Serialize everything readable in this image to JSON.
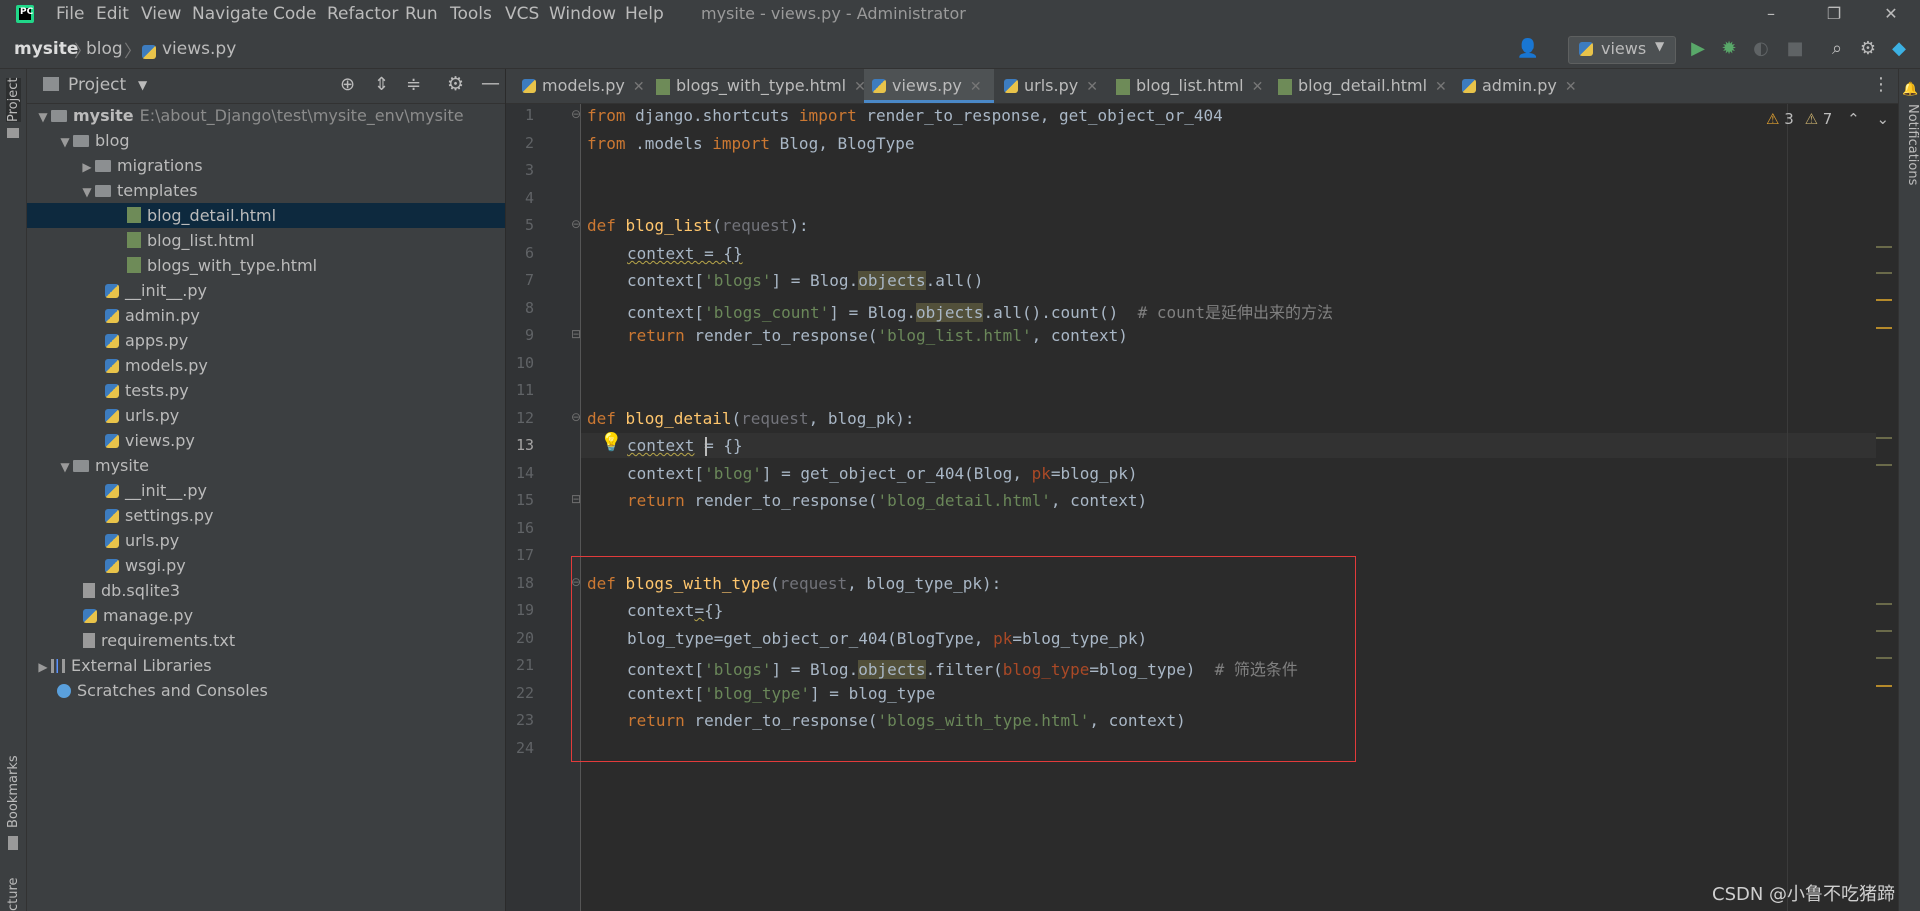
{
  "titlebar": {
    "logo": "PC",
    "menus": [
      "File",
      "Edit",
      "View",
      "Navigate",
      "Code",
      "Refactor",
      "Run",
      "Tools",
      "VCS",
      "Window",
      "Help"
    ],
    "title": "mysite - views.py - Administrator"
  },
  "breadcrumb": [
    "mysite",
    "blog",
    "views.py"
  ],
  "toolbar": {
    "run_config": "views"
  },
  "left_strip": {
    "project": "Project",
    "bookmarks": "Bookmarks",
    "structure": "cture"
  },
  "right_strip": {
    "notifications": "Notifications"
  },
  "project_panel": {
    "title": "Project",
    "root_name": "mysite",
    "root_path": "E:\\about_Django\\test\\mysite_env\\mysite",
    "items": [
      {
        "label": "blog"
      },
      {
        "label": "migrations"
      },
      {
        "label": "templates"
      },
      {
        "label": "blog_detail.html"
      },
      {
        "label": "blog_list.html"
      },
      {
        "label": "blogs_with_type.html"
      },
      {
        "label": "__init__.py"
      },
      {
        "label": "admin.py"
      },
      {
        "label": "apps.py"
      },
      {
        "label": "models.py"
      },
      {
        "label": "tests.py"
      },
      {
        "label": "urls.py"
      },
      {
        "label": "views.py"
      },
      {
        "label": "mysite"
      },
      {
        "label": "__init__.py"
      },
      {
        "label": "settings.py"
      },
      {
        "label": "urls.py"
      },
      {
        "label": "wsgi.py"
      },
      {
        "label": "db.sqlite3"
      },
      {
        "label": "manage.py"
      },
      {
        "label": "requirements.txt"
      },
      {
        "label": "External Libraries"
      },
      {
        "label": "Scratches and Consoles"
      }
    ]
  },
  "tabs": [
    "models.py",
    "blogs_with_type.html",
    "views.py",
    "urls.py",
    "blog_list.html",
    "blog_detail.html",
    "admin.py"
  ],
  "inspections": {
    "warnings": "3",
    "weak_warnings": "7"
  },
  "line_numbers": [
    "1",
    "2",
    "3",
    "4",
    "5",
    "6",
    "7",
    "8",
    "9",
    "10",
    "11",
    "12",
    "13",
    "14",
    "15",
    "16",
    "17",
    "18",
    "19",
    "20",
    "21",
    "22",
    "23",
    "24"
  ],
  "code": {
    "l1": [
      "from",
      " django.shortcuts ",
      "import",
      " render_to_response, get_object_or_404"
    ],
    "l2": [
      "from",
      " .models ",
      "import",
      " Blog, BlogType"
    ],
    "l5": [
      "def ",
      "blog_list",
      "(",
      "request",
      "):"
    ],
    "l6": [
      "context = {}"
    ],
    "l7": [
      "context[",
      "'blogs'",
      "] = Blog.",
      "objects",
      ".all()"
    ],
    "l8": [
      "context[",
      "'blogs_count'",
      "] = Blog.",
      "objects",
      ".all().count()  ",
      "# count是延伸出来的方法"
    ],
    "l9": [
      "return",
      " render_to_response(",
      "'blog_list.html'",
      ", context)"
    ],
    "l12": [
      "def ",
      "blog_detail",
      "(",
      "request",
      ", blog_pk):"
    ],
    "l13": [
      "context",
      " = {}"
    ],
    "l14": [
      "context[",
      "'blog'",
      "] = get_object_or_404(Blog, ",
      "pk",
      "=blog_pk)"
    ],
    "l15": [
      "return",
      " render_to_response(",
      "'blog_detail.html'",
      ", context)"
    ],
    "l18": [
      "def ",
      "blogs_with_type",
      "(",
      "request",
      ", blog_type_pk):"
    ],
    "l19": [
      "context",
      "=",
      "{}"
    ],
    "l20": [
      "blog_type",
      "=",
      "get_object_or_404(BlogType, ",
      "pk",
      "=blog_type_pk)"
    ],
    "l21": [
      "context[",
      "'blogs'",
      "] = Blog.",
      "objects",
      ".filter(",
      "blog_type",
      "=blog_type)  ",
      "# 筛选条件"
    ],
    "l22": [
      "context[",
      "'blog_type'",
      "] = blog_type"
    ],
    "l23": [
      "return",
      " render_to_response(",
      "'blogs_with_type.html'",
      ", context)"
    ]
  },
  "watermark": "CSDN @小鲁不吃猪蹄",
  "colors": {
    "keyword": "#cc7832",
    "function": "#ffc66d",
    "string": "#6a8759",
    "comment": "#808080",
    "highlight_box": "#e23b3b"
  }
}
